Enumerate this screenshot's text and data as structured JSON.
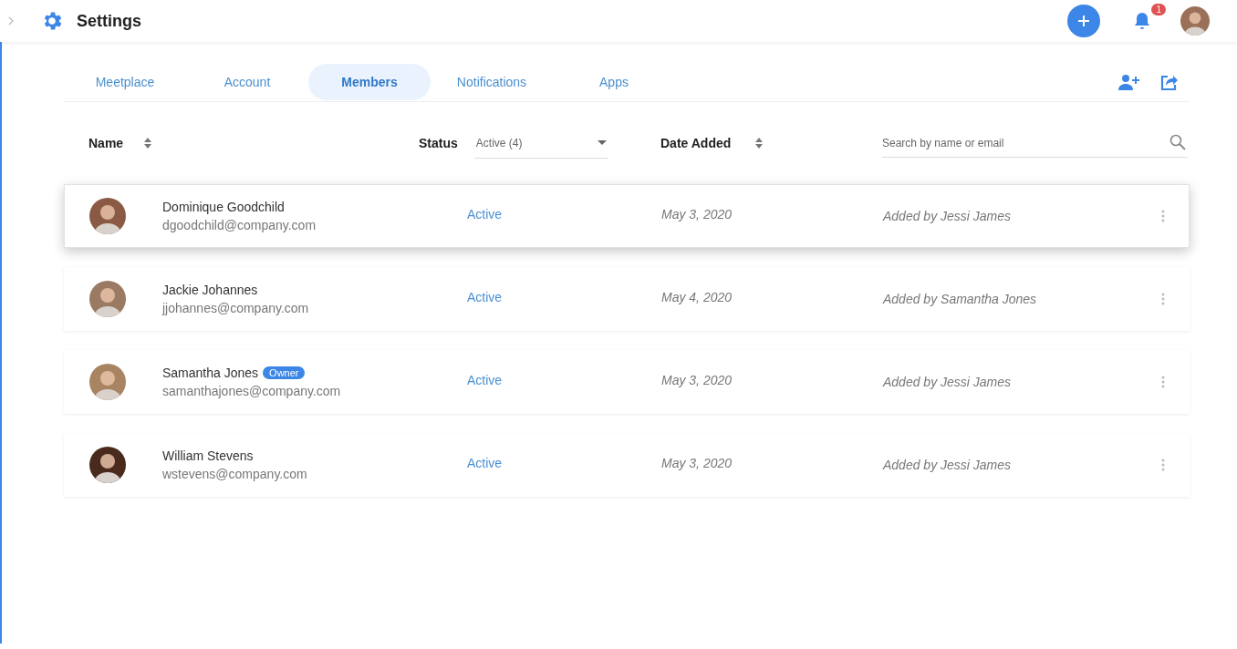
{
  "topbar": {
    "title": "Settings",
    "notification_count": "1"
  },
  "tabs": [
    {
      "label": "Meetplace",
      "selected": false
    },
    {
      "label": "Account",
      "selected": false
    },
    {
      "label": "Members",
      "selected": true
    },
    {
      "label": "Notifications",
      "selected": false
    },
    {
      "label": "Apps",
      "selected": false
    }
  ],
  "table": {
    "columns": [
      {
        "label": "Name",
        "sortable": true
      },
      {
        "label": "Status",
        "sortable": false
      },
      {
        "label": "Date Added",
        "sortable": true
      }
    ],
    "status_filter": "Active (4)",
    "search": {
      "placeholder": "Search by name or email"
    },
    "rows": [
      {
        "name": "Dominique Goodchild",
        "email": "dgoodchild@company.com",
        "status": "Active",
        "date": "May 3, 2020",
        "added_by": "Added by Jessi James",
        "selected": true
      },
      {
        "name": "Jackie Johannes",
        "email": "jjohannes@company.com",
        "status": "Active",
        "date": "May 4, 2020",
        "added_by": "Added by Samantha Jones",
        "selected": false
      },
      {
        "name": "Samantha Jones",
        "badge": "Owner",
        "email": "samanthajones@company.com",
        "status": "Active",
        "date": "May 3, 2020",
        "added_by": "Added by Jessi James",
        "selected": false
      },
      {
        "name": "William Stevens",
        "email": "wstevens@company.com",
        "status": "Active",
        "date": "May 3, 2020",
        "added_by": "Added by Jessi James",
        "selected": false
      }
    ]
  }
}
